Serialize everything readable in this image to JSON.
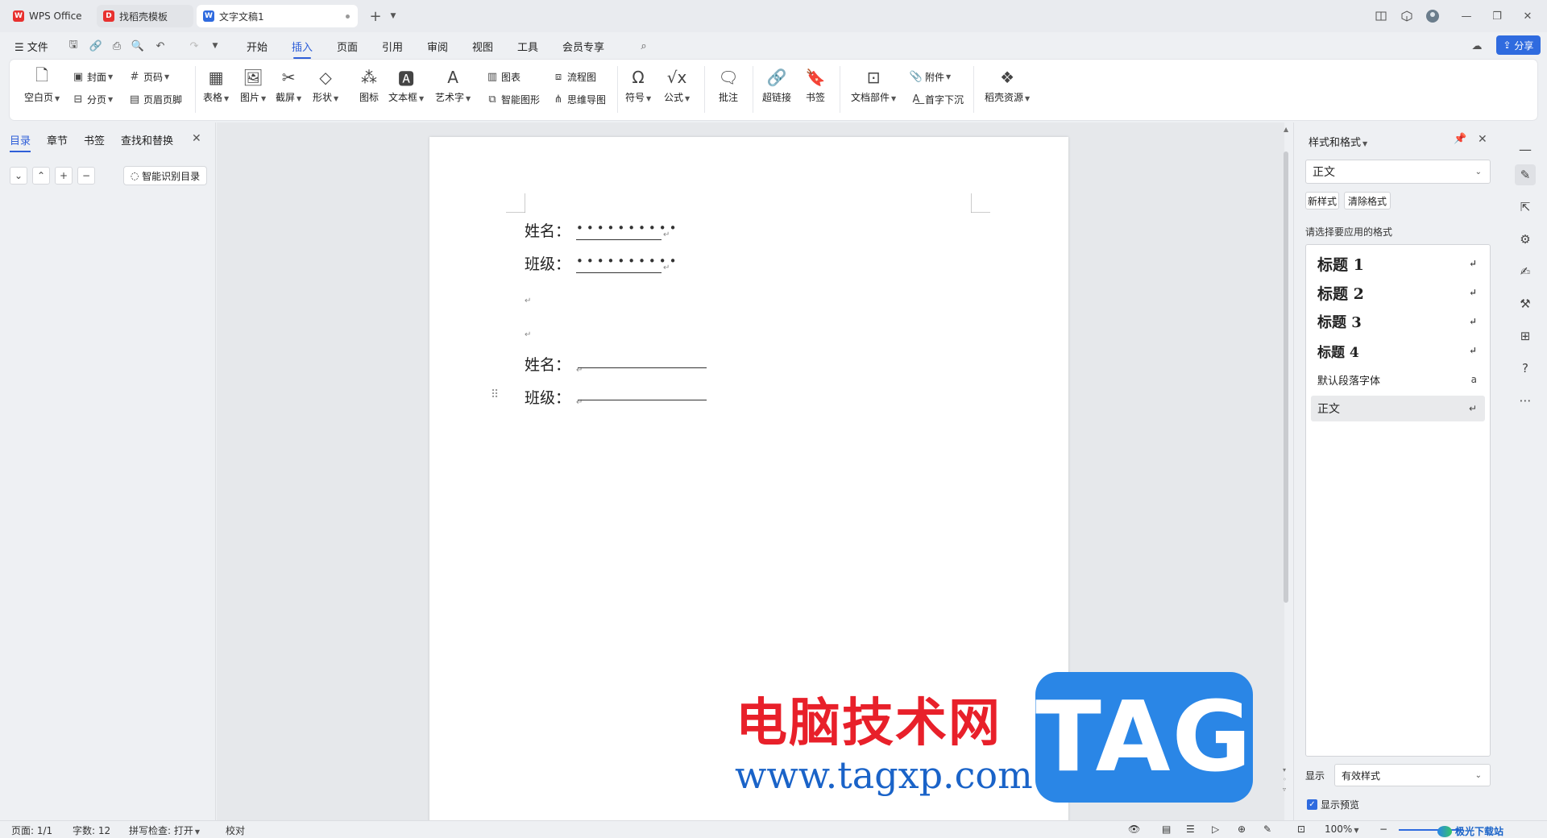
{
  "tabs": [
    {
      "label": "WPS Office",
      "icon": "wps-logo-icon"
    },
    {
      "label": "找稻壳模板",
      "icon": "docer-icon"
    },
    {
      "label": "文字文稿1",
      "icon": "writer-doc-icon"
    }
  ],
  "menu": {
    "file": "文件",
    "items": [
      "开始",
      "插入",
      "页面",
      "引用",
      "审阅",
      "视图",
      "工具",
      "会员专享"
    ],
    "active": "插入",
    "share": "分享"
  },
  "ribbon": {
    "blank_page": "空白页",
    "cover": "封面",
    "page_break": "分页",
    "page_number": "页码",
    "header_footer": "页眉页脚",
    "table": "表格",
    "picture": "图片",
    "screenshot": "截屏",
    "shape": "形状",
    "icon": "图标",
    "textbox": "文本框",
    "wordart": "艺术字",
    "chart": "图表",
    "smart_graphic": "智能图形",
    "flowchart": "流程图",
    "mindmap": "思维导图",
    "symbol": "符号",
    "formula": "公式",
    "comment": "批注",
    "hyperlink": "超链接",
    "bookmark": "书签",
    "doc_parts": "文档部件",
    "attachment": "附件",
    "drop_cap": "首字下沉",
    "docer_resources": "稻壳资源"
  },
  "nav": {
    "tabs": [
      "目录",
      "章节",
      "书签",
      "查找和替换"
    ],
    "active": "目录",
    "smart_toc": "智能识别目录"
  },
  "document": {
    "line1_label": "姓名：",
    "line2_label": "班级：",
    "line3_label": "姓名：",
    "line4_label": "班级："
  },
  "watermark": {
    "site_name": "电脑技术网",
    "url": "www.tagxp.com",
    "tag": "TAG",
    "corner_brand": "极光下载站"
  },
  "styles_panel": {
    "title": "样式和格式",
    "current_style": "正文",
    "new_style": "新样式",
    "clear_format": "清除格式",
    "hint": "请选择要应用的格式",
    "items": [
      {
        "label": "标题  1",
        "mark": "↵"
      },
      {
        "label": "标题  2",
        "mark": "↵"
      },
      {
        "label": "标题  3",
        "mark": "↵"
      },
      {
        "label": "标题  4",
        "mark": "↵"
      },
      {
        "label": "默认段落字体",
        "mark": "a"
      },
      {
        "label": "正文",
        "mark": "↵"
      }
    ],
    "show_label": "显示",
    "show_value": "有效样式",
    "preview_label": "显示预览"
  },
  "status": {
    "page": "页面: 1/1",
    "words": "字数: 12",
    "spell": "拼写检查: 打开",
    "proof": "校对",
    "zoom": "100%"
  },
  "colors": {
    "accent": "#2f5fd8",
    "share_bg": "#2f6bdf",
    "watermark_red": "#e8202a",
    "watermark_blue": "#1a63c8",
    "tag_bg": "#2a86e6"
  }
}
